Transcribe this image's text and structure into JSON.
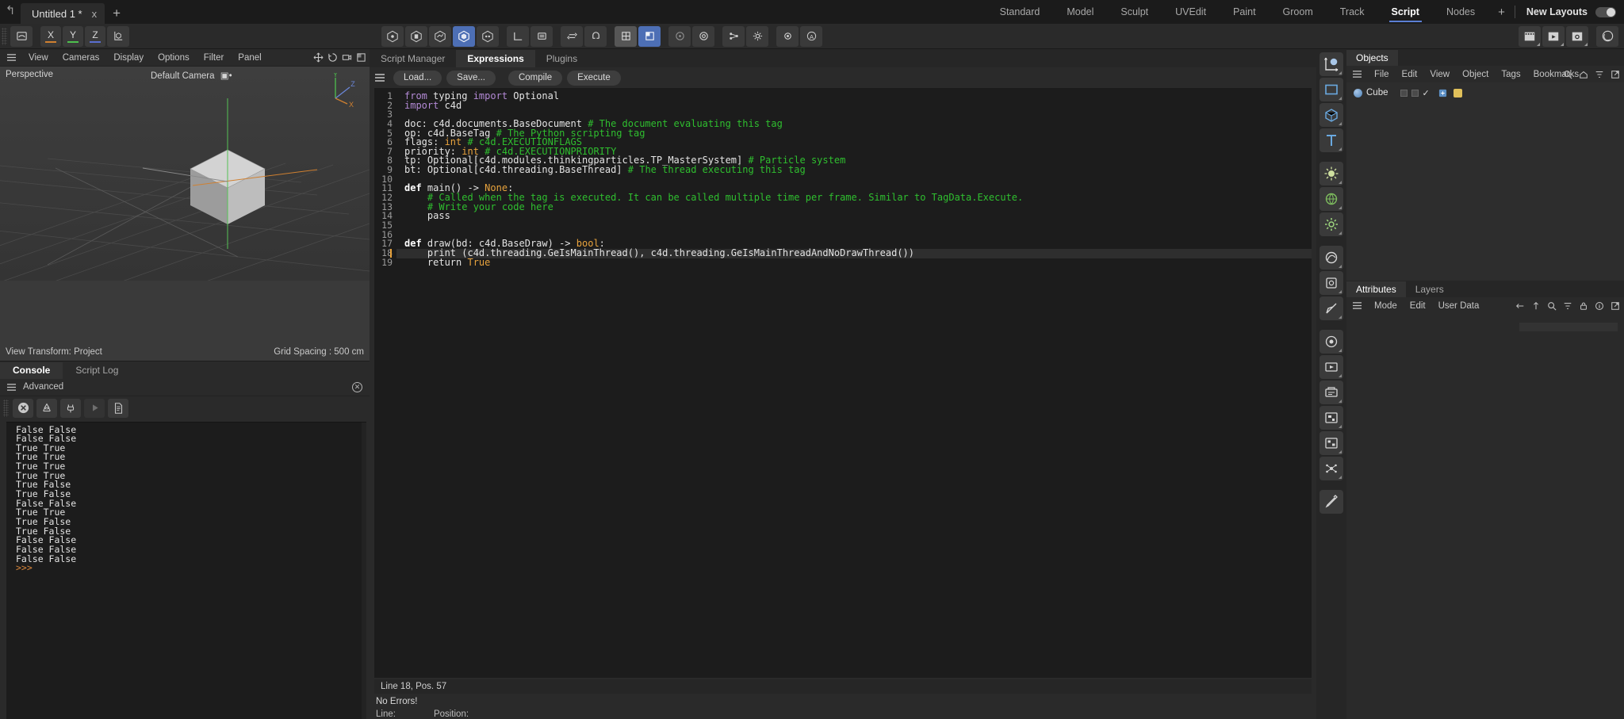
{
  "titlebar": {
    "undo_icon": "undo-arrow-icon",
    "document_tab": "Untitled 1 *",
    "close_label": "x",
    "new_tab_label": "+",
    "layout_tabs": [
      {
        "label": "Standard",
        "active": false
      },
      {
        "label": "Model",
        "active": false
      },
      {
        "label": "Sculpt",
        "active": false
      },
      {
        "label": "UVEdit",
        "active": false
      },
      {
        "label": "Paint",
        "active": false
      },
      {
        "label": "Groom",
        "active": false
      },
      {
        "label": "Track",
        "active": false
      },
      {
        "label": "Script",
        "active": true
      },
      {
        "label": "Nodes",
        "active": false
      }
    ],
    "add_layout_label": "+",
    "new_layouts_label": "New Layouts",
    "toggle_state": "on"
  },
  "toolbar": {
    "axis_labels": [
      "X",
      "Y",
      "Z"
    ],
    "axis_colors": [
      "#d08030",
      "#4ec04e",
      "#5a6fd0"
    ],
    "icons": [
      "undo-redo-icon",
      "world-axis-icon",
      "render-view-icon",
      "render-region-icon",
      "render-settings-icon",
      "select-mode-icon",
      "scale-mode-icon",
      "rotate-icon",
      "magnet-icon",
      "workplane-icon",
      "snap-icon",
      "quantize-icon",
      "deformer-icon",
      "array-icon",
      "settings-icon",
      "light-icon",
      "camera-icon"
    ]
  },
  "viewport": {
    "menus": [
      "View",
      "Cameras",
      "Display",
      "Options",
      "Filter",
      "Panel"
    ],
    "perspective_label": "Perspective",
    "camera_label": "Default Camera",
    "move_label": "Move",
    "view_transform": "View Transform: Project",
    "grid_spacing": "Grid Spacing : 500 cm",
    "axis_gizmo": {
      "x": "X",
      "y": "Y",
      "z": "Z"
    }
  },
  "console": {
    "tabs": [
      {
        "label": "Console",
        "active": true
      },
      {
        "label": "Script Log",
        "active": false
      }
    ],
    "menu_label": "Advanced",
    "toolbar_icons": [
      "clear-console-icon",
      "recycle-icon",
      "plug-icon",
      "play-icon",
      "document-icon"
    ],
    "output": [
      "False False",
      "False False",
      "True True",
      "True True",
      "True True",
      "True True",
      "True False",
      "True False",
      "False False",
      "True True",
      "True False",
      "True False",
      "False False",
      "False False",
      "False False"
    ],
    "prompt": ">>>"
  },
  "script_manager": {
    "tabs": [
      {
        "label": "Script Manager",
        "active": false
      },
      {
        "label": "Expressions",
        "active": true
      },
      {
        "label": "Plugins",
        "active": false
      }
    ],
    "buttons": [
      "Load...",
      "Save...",
      "Compile",
      "Execute"
    ],
    "status_line": "Line 18, Pos. 57",
    "errors": "No Errors!",
    "bottom_line_label": "Line:",
    "bottom_position_label": "Position:",
    "code_lines": [
      {
        "n": 1,
        "tokens": [
          {
            "t": "from ",
            "c": "imp"
          },
          {
            "t": "typing ",
            "c": ""
          },
          {
            "t": "import ",
            "c": "imp"
          },
          {
            "t": "Optional",
            "c": ""
          }
        ]
      },
      {
        "n": 2,
        "tokens": [
          {
            "t": "import ",
            "c": "imp"
          },
          {
            "t": "c4d",
            "c": ""
          }
        ]
      },
      {
        "n": 3,
        "tokens": []
      },
      {
        "n": 4,
        "tokens": [
          {
            "t": "doc: c4d.documents.BaseDocument ",
            "c": ""
          },
          {
            "t": "# The document evaluating this tag",
            "c": "cm"
          }
        ]
      },
      {
        "n": 5,
        "tokens": [
          {
            "t": "op: c4d.BaseTag ",
            "c": ""
          },
          {
            "t": "# The Python scripting tag",
            "c": "cm"
          }
        ]
      },
      {
        "n": 6,
        "tokens": [
          {
            "t": "flags: ",
            "c": ""
          },
          {
            "t": "int",
            "c": "bi"
          },
          {
            "t": " ",
            "c": ""
          },
          {
            "t": "# c4d.EXECUTIONFLAGS",
            "c": "cm"
          }
        ]
      },
      {
        "n": 7,
        "tokens": [
          {
            "t": "priority: ",
            "c": ""
          },
          {
            "t": "int",
            "c": "bi"
          },
          {
            "t": " ",
            "c": ""
          },
          {
            "t": "# c4d.EXECUTIONPRIORITY",
            "c": "cm"
          }
        ]
      },
      {
        "n": 8,
        "tokens": [
          {
            "t": "tp: Optional[c4d.modules.thinkingparticles.TP_MasterSystem] ",
            "c": ""
          },
          {
            "t": "# Particle system",
            "c": "cm"
          }
        ]
      },
      {
        "n": 9,
        "tokens": [
          {
            "t": "bt: Optional[c4d.threading.BaseThread] ",
            "c": ""
          },
          {
            "t": "# The thread executing this tag",
            "c": "cm"
          }
        ]
      },
      {
        "n": 10,
        "tokens": []
      },
      {
        "n": 11,
        "tokens": [
          {
            "t": "def",
            "c": "kw"
          },
          {
            "t": " main() -> ",
            "c": ""
          },
          {
            "t": "None",
            "c": "bi"
          },
          {
            "t": ":",
            "c": ""
          }
        ]
      },
      {
        "n": 12,
        "tokens": [
          {
            "t": "    # Called when the tag is executed. It can be called multiple time per frame. Similar to TagData.Execute.",
            "c": "cm"
          }
        ]
      },
      {
        "n": 13,
        "tokens": [
          {
            "t": "    # Write your code here",
            "c": "cm"
          }
        ]
      },
      {
        "n": 14,
        "tokens": [
          {
            "t": "    pass",
            "c": ""
          }
        ]
      },
      {
        "n": 15,
        "tokens": []
      },
      {
        "n": 16,
        "tokens": []
      },
      {
        "n": 17,
        "tokens": [
          {
            "t": "def",
            "c": "kw"
          },
          {
            "t": " draw(bd: c4d.BaseDraw) -> ",
            "c": ""
          },
          {
            "t": "bool",
            "c": "bi"
          },
          {
            "t": ":",
            "c": ""
          }
        ]
      },
      {
        "n": 18,
        "tokens": [
          {
            "t": "    print (c4d.threading.GeIsMainThread(), c4d.threading.GeIsMainThreadAndNoDrawThread())",
            "c": ""
          }
        ],
        "highlight": true
      },
      {
        "n": 19,
        "tokens": [
          {
            "t": "    return ",
            "c": ""
          },
          {
            "t": "True",
            "c": "bi"
          }
        ]
      }
    ]
  },
  "rail": {
    "icons": [
      "axis-sphere-icon",
      "rectangle-icon",
      "cube-icon",
      "text-icon",
      "light-green-icon",
      "environment-icon",
      "gear-icon",
      "spline-icon",
      "polygon-icon",
      "knife-icon",
      "cloner-icon",
      "simulation-icon",
      "render-queue-icon",
      "scene-nodes-icon",
      "scene-manager-icon",
      "particles-icon",
      "pen-icon"
    ]
  },
  "objects_panel": {
    "tab_label": "Objects",
    "menus": [
      "File",
      "Edit",
      "View",
      "Object",
      "Tags",
      "Bookmarks"
    ],
    "right_icons": [
      "search-icon",
      "home-icon",
      "filter-icon",
      "popout-icon"
    ],
    "items": [
      {
        "name": "Cube",
        "icon": "cube-object-icon",
        "visible": true,
        "tag_color": "#4a7fb5"
      }
    ]
  },
  "attributes_panel": {
    "tabs": [
      {
        "label": "Attributes",
        "active": true
      },
      {
        "label": "Layers",
        "active": false
      }
    ],
    "menus": [
      "Mode",
      "Edit",
      "User Data"
    ],
    "right_icons": [
      "back-arrow-icon",
      "up-arrow-icon",
      "search-icon",
      "filter-icon",
      "lock-icon",
      "info-icon",
      "popout-icon"
    ]
  },
  "colors": {
    "accent_blue": "#4d6fb5",
    "tab_underline": "#5b7fd4",
    "comment_green": "#2fbf2f",
    "builtin_orange": "#e8a33d",
    "import_purple": "#b48ad6",
    "bg_dark": "#1c1c1c",
    "panel_bg": "#2a2a2a"
  }
}
